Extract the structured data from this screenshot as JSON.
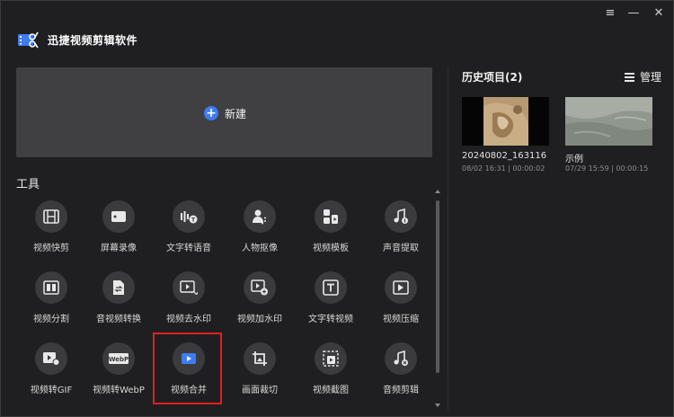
{
  "app": {
    "title": "迅捷视频剪辑软件"
  },
  "window_controls": {
    "menu": "≡",
    "minimize": "—",
    "close": "✕"
  },
  "new_project": {
    "label": "新建",
    "icon": "plus-icon"
  },
  "tools": {
    "heading": "工具",
    "items": [
      {
        "label": "视频快剪",
        "icon": "film-icon"
      },
      {
        "label": "屏幕录像",
        "icon": "screen-record-icon"
      },
      {
        "label": "文字转语音",
        "icon": "text-to-speech-icon"
      },
      {
        "label": "人物抠像",
        "icon": "person-cutout-icon"
      },
      {
        "label": "视频模板",
        "icon": "template-icon"
      },
      {
        "label": "声音提取",
        "icon": "music-extract-icon"
      },
      {
        "label": "视频分割",
        "icon": "video-split-icon"
      },
      {
        "label": "音视频转换",
        "icon": "convert-icon"
      },
      {
        "label": "视频去水印",
        "icon": "remove-watermark-icon"
      },
      {
        "label": "视频加水印",
        "icon": "add-watermark-icon"
      },
      {
        "label": "文字转视频",
        "icon": "text-to-video-icon"
      },
      {
        "label": "视频压缩",
        "icon": "compress-icon"
      },
      {
        "label": "视频转GIF",
        "icon": "gif-icon"
      },
      {
        "label": "视频转WebP",
        "icon": "webp-icon"
      },
      {
        "label": "视频合并",
        "icon": "merge-icon"
      },
      {
        "label": "画面裁切",
        "icon": "crop-icon"
      },
      {
        "label": "视频截图",
        "icon": "screenshot-icon"
      },
      {
        "label": "音频剪辑",
        "icon": "audio-cut-icon"
      }
    ],
    "highlighted": "视频合并"
  },
  "history": {
    "title": "历史项目(2)",
    "manage_label": "管理",
    "items": [
      {
        "name": "20240802_163116",
        "meta": "08/02 16:31 | 00:00:02"
      },
      {
        "name": "示例",
        "meta": "07/29 15:59 | 00:00:15"
      }
    ]
  },
  "colors": {
    "background": "#1f1f21",
    "card": "#404043",
    "accent": "#3d7cf2",
    "highlight": "#e0201f"
  }
}
